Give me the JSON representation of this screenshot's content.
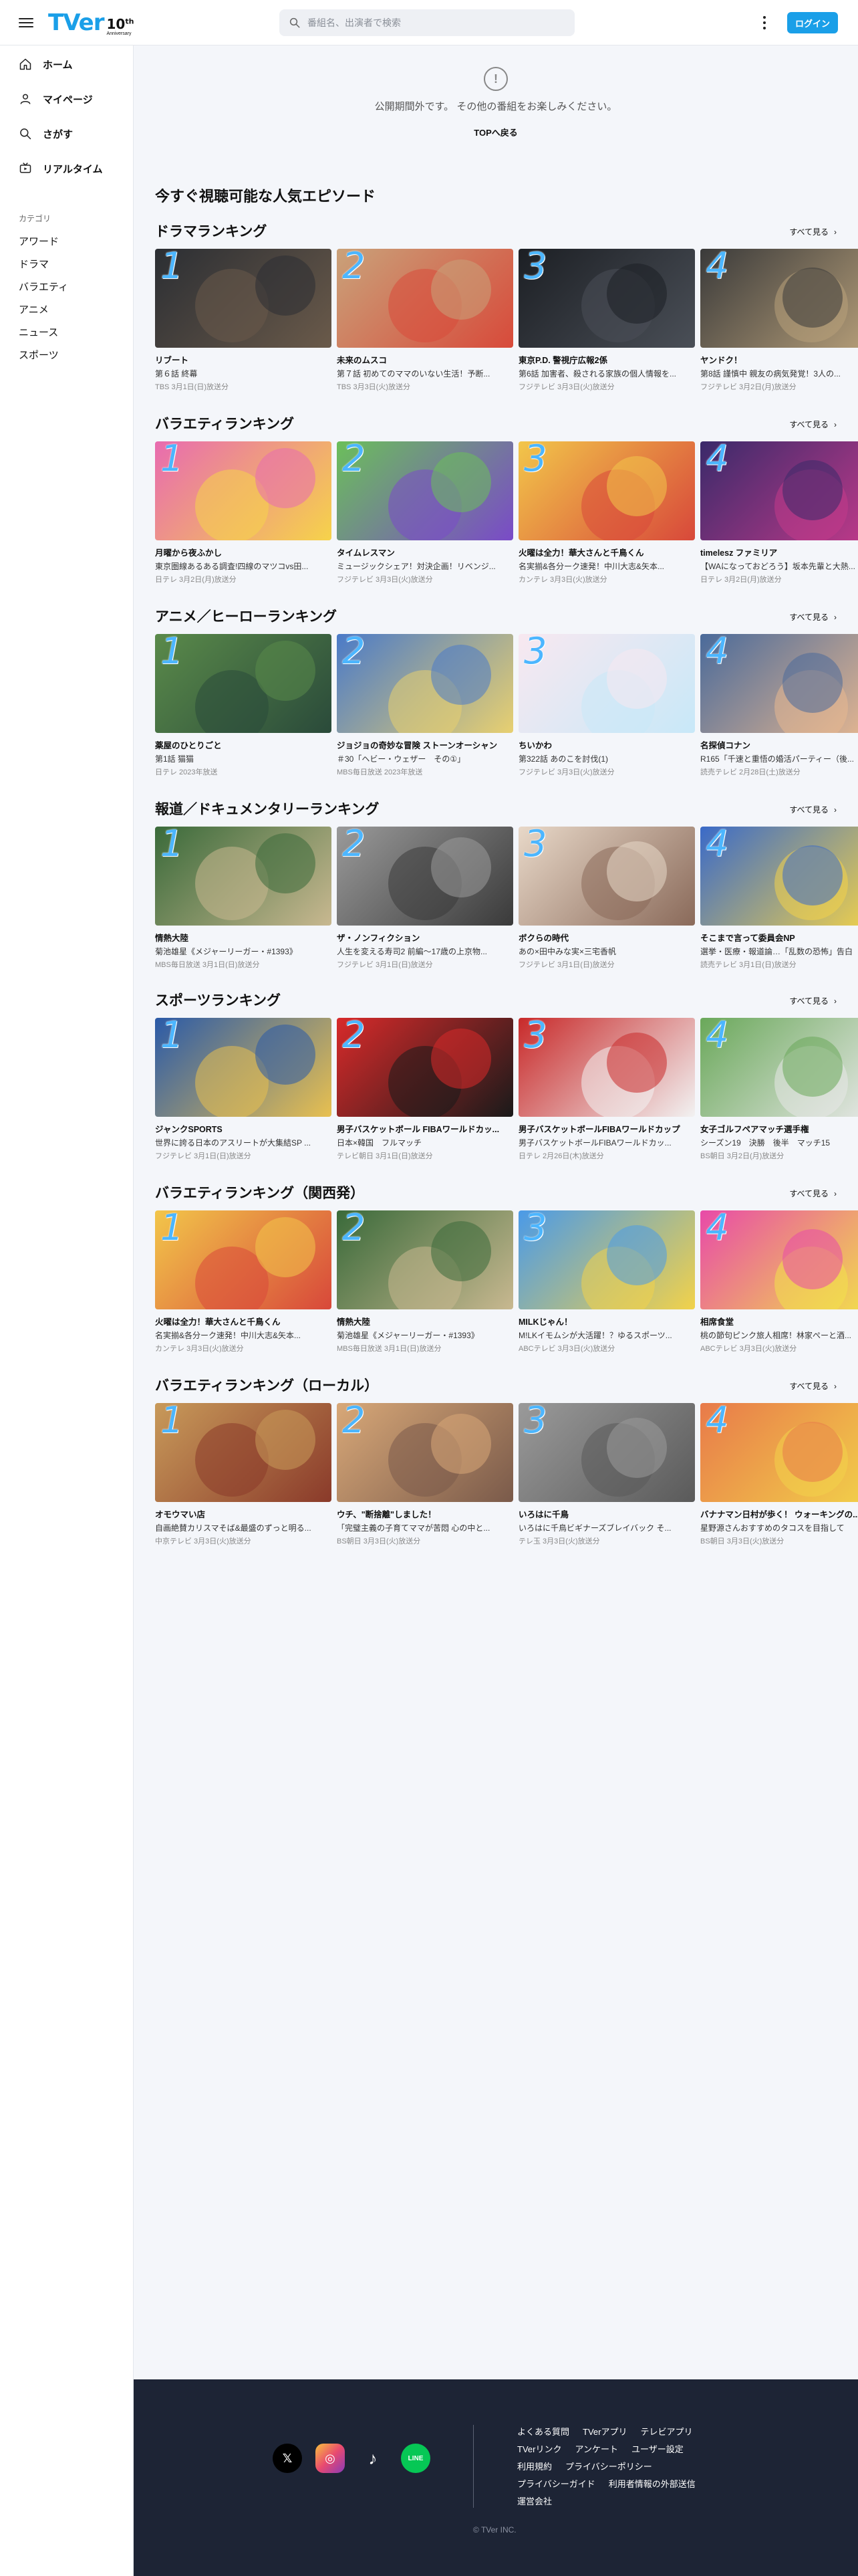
{
  "header": {
    "logo_text": "TVer",
    "logo_badge": "10",
    "logo_badge_sup": "th",
    "logo_badge_sub": "Anniversary",
    "search_placeholder": "番組名、出演者で検索",
    "login_label": "ログイン"
  },
  "sidebar": {
    "nav": [
      {
        "label": "ホーム",
        "icon": "home-icon"
      },
      {
        "label": "マイページ",
        "icon": "user-icon"
      },
      {
        "label": "さがす",
        "icon": "search-icon"
      },
      {
        "label": "リアルタイム",
        "icon": "tv-icon"
      }
    ],
    "category_title": "カテゴリ",
    "categories": [
      "アワード",
      "ドラマ",
      "バラエティ",
      "アニメ",
      "ニュース",
      "スポーツ"
    ]
  },
  "notice": {
    "message": "公開期間外です。 その他の番組をお楽しみください。",
    "top_link": "TOPへ戻る"
  },
  "page_heading": "今すぐ視聴可能な人気エピソード",
  "see_all_label": "すべて見る",
  "sections": [
    {
      "title": "ドラマランキング",
      "cards": [
        {
          "rank": "1",
          "title": "リブート",
          "sub": "第６話 終幕",
          "meta": "TBS 3月1日(日)放送分",
          "colors": [
            "#2b2e33",
            "#6a5a4a"
          ]
        },
        {
          "rank": "2",
          "title": "未来のムスコ",
          "sub": "第７話 初めてのママのいない生活！予断...",
          "meta": "TBS 3月3日(火)放送分",
          "colors": [
            "#c9a27a",
            "#d84a3a"
          ]
        },
        {
          "rank": "3",
          "title": "東京P.D. 警視庁広報2係",
          "sub": "第6話 加害者、殺される家族の個人情報を...",
          "meta": "フジテレビ 3月3日(火)放送分",
          "colors": [
            "#1c1f24",
            "#4a4f57"
          ]
        },
        {
          "rank": "4",
          "title": "ヤンドク！",
          "sub": "第8話 謹慎中 親友の病気発覚！3人の...",
          "meta": "フジテレビ 3月2日(月)放送分",
          "colors": [
            "#3a3a3a",
            "#b8a07a"
          ]
        }
      ]
    },
    {
      "title": "バラエティランキング",
      "cards": [
        {
          "rank": "1",
          "title": "月曜から夜ふかし",
          "sub": "東京圏線あるある調査!四線のマツコvs田...",
          "meta": "日テレ 3月2日(月)放送分",
          "colors": [
            "#e86bb0",
            "#f6d34a"
          ]
        },
        {
          "rank": "2",
          "title": "タイムレスマン",
          "sub": "ミュージックシェア！対決企画！リベンジ...",
          "meta": "フジテレビ 3月3日(火)放送分",
          "colors": [
            "#6bbf5a",
            "#7a4ac8"
          ]
        },
        {
          "rank": "3",
          "title": "火曜は全力！華大さんと千鳥くん",
          "sub": "名実揃&各分ーク速発！中川大志&矢本...",
          "meta": "カンテレ 3月3日(火)放送分",
          "colors": [
            "#f2c64a",
            "#d8483a"
          ]
        },
        {
          "rank": "4",
          "title": "timelesz ファミリア",
          "sub": "【WAになっておどろう】坂本先輩と大熱...",
          "meta": "日テレ 3月2日(月)放送分",
          "colors": [
            "#3a2a6a",
            "#c23a8a"
          ]
        }
      ]
    },
    {
      "title": "アニメ／ヒーローランキング",
      "cards": [
        {
          "rank": "1",
          "title": "薬屋のひとりごと",
          "sub": "第1話 猫猫",
          "meta": "日テレ 2023年放送",
          "colors": [
            "#5a8a4a",
            "#2a4a3a"
          ]
        },
        {
          "rank": "2",
          "title": "ジョジョの奇妙な冒険 ストーンオーシャン",
          "sub": "＃30「ヘビー・ウェザー　その①」",
          "meta": "MBS毎日放送 2023年放送",
          "colors": [
            "#4a7ac8",
            "#e8d070"
          ]
        },
        {
          "rank": "3",
          "title": "ちいかわ",
          "sub": "第322話 あのこを討伐(1)",
          "meta": "フジテレビ 3月3日(火)放送分",
          "colors": [
            "#f8e8f0",
            "#c8e8f8"
          ]
        },
        {
          "rank": "4",
          "title": "名探偵コナン",
          "sub": "R165「千速と重悟の婚活パーティー（後...",
          "meta": "読売テレビ 2月28日(土)放送分",
          "colors": [
            "#4a6a9a",
            "#e8b890"
          ]
        }
      ]
    },
    {
      "title": "報道／ドキュメンタリーランキング",
      "cards": [
        {
          "rank": "1",
          "title": "情熱大陸",
          "sub": "菊池雄星《メジャーリーガー・#1393》",
          "meta": "MBS毎日放送 3月1日(日)放送分",
          "colors": [
            "#3a6a3a",
            "#c8b890"
          ]
        },
        {
          "rank": "2",
          "title": "ザ・ノンフィクション",
          "sub": "人生を変える寿司2 前編～17歳の上京物...",
          "meta": "フジテレビ 3月1日(日)放送分",
          "colors": [
            "#9a9a9a",
            "#3a3a3a"
          ]
        },
        {
          "rank": "3",
          "title": "ボクらの時代",
          "sub": "あの×田中みな実×三宅香帆",
          "meta": "フジテレビ 3月1日(日)放送分",
          "colors": [
            "#e8d8c8",
            "#8a6a5a"
          ]
        },
        {
          "rank": "4",
          "title": "そこまで言って委員会NP",
          "sub": "選挙・医療・報道論…「乱数の恐怖」告白",
          "meta": "読売テレビ 3月1日(日)放送分",
          "colors": [
            "#3a6ac8",
            "#f2d24a"
          ]
        }
      ]
    },
    {
      "title": "スポーツランキング",
      "cards": [
        {
          "rank": "1",
          "title": "ジャンクSPORTS",
          "sub": "世界に誇る日本のアスリートが大集結SP ...",
          "meta": "フジテレビ 3月1日(日)放送分",
          "colors": [
            "#2a5aa8",
            "#e8c050"
          ]
        },
        {
          "rank": "2",
          "title": "男子バスケットボール FIBAワールドカッ...",
          "sub": "日本×韓国　フルマッチ",
          "meta": "テレビ朝日 3月1日(日)放送分",
          "colors": [
            "#d82a2a",
            "#1a1a1a"
          ]
        },
        {
          "rank": "3",
          "title": "男子バスケットボールFIBAワールドカップ",
          "sub": "男子バスケットボールFIBAワールドカッ...",
          "meta": "日テレ 2月26日(木)放送分",
          "colors": [
            "#c82a2a",
            "#f2f2f2"
          ]
        },
        {
          "rank": "4",
          "title": "女子ゴルフペアマッチ選手権",
          "sub": "シーズン19　決勝　後半　マッチ15",
          "meta": "BS朝日 3月2日(月)放送分",
          "colors": [
            "#6aa85a",
            "#e8e8e8"
          ]
        }
      ]
    },
    {
      "title": "バラエティランキング（関西発）",
      "cards": [
        {
          "rank": "1",
          "title": "火曜は全力！華大さんと千鳥くん",
          "sub": "名実揃&各分ーク速発！中川大志&矢本...",
          "meta": "カンテレ 3月3日(火)放送分",
          "colors": [
            "#f2c64a",
            "#d8483a"
          ]
        },
        {
          "rank": "2",
          "title": "情熱大陸",
          "sub": "菊池雄星《メジャーリーガー・#1393》",
          "meta": "MBS毎日放送 3月1日(日)放送分",
          "colors": [
            "#3a6a3a",
            "#c8b890"
          ]
        },
        {
          "rank": "3",
          "title": "MILKじゃん！",
          "sub": "M!LKイモムシが大活躍！？ゆるスポーツ...",
          "meta": "ABCテレビ 3月3日(火)放送分",
          "colors": [
            "#4a9ae8",
            "#f2d24a"
          ]
        },
        {
          "rank": "4",
          "title": "相席食堂",
          "sub": "桃の節句ピンク旅人相席！林家ぺーと酒...",
          "meta": "ABCテレビ 3月3日(火)放送分",
          "colors": [
            "#e84aa8",
            "#f2e24a"
          ]
        }
      ]
    },
    {
      "title": "バラエティランキング（ローカル）",
      "cards": [
        {
          "rank": "1",
          "title": "オモウマい店",
          "sub": "自画絶賛カリスマそば&最盛のずっと明る...",
          "meta": "中京テレビ 3月3日(火)放送分",
          "colors": [
            "#c89a5a",
            "#8a3a2a"
          ]
        },
        {
          "rank": "2",
          "title": "ウチ、\"断捨離\"しました！",
          "sub": "「完璧主義の子育てママが苦悶 心の中と...",
          "meta": "BS朝日 3月3日(火)放送分",
          "colors": [
            "#d8a878",
            "#7a5a4a"
          ]
        },
        {
          "rank": "3",
          "title": "いろはに千鳥",
          "sub": "いろはに千鳥ビギナーズブレイバック そ...",
          "meta": "テレ玉 3月3日(火)放送分",
          "colors": [
            "#9a9a9a",
            "#5a5a5a"
          ]
        },
        {
          "rank": "4",
          "title": "バナナマン日村が歩く！ ウォーキングの...",
          "sub": "星野源さんおすすめのタコスを目指して",
          "meta": "BS朝日 3月3日(火)放送分",
          "colors": [
            "#e87a4a",
            "#f2d24a"
          ]
        }
      ]
    }
  ],
  "footer": {
    "social": [
      {
        "name": "x-icon",
        "glyph": "𝕏"
      },
      {
        "name": "instagram-icon",
        "glyph": "◎"
      },
      {
        "name": "tiktok-icon",
        "glyph": "♪"
      },
      {
        "name": "line-icon",
        "glyph": "LINE"
      }
    ],
    "link_rows": [
      [
        "よくある質問",
        "TVerアプリ",
        "テレビアプリ"
      ],
      [
        "TVerリンク",
        "アンケート",
        "ユーザー設定"
      ],
      [
        "利用規約",
        "プライバシーポリシー"
      ],
      [
        "プライバシーガイド",
        "利用者情報の外部送信"
      ],
      [
        "運営会社"
      ]
    ],
    "copyright": "© TVer INC."
  },
  "colors": {
    "brand": "#1a9fe8",
    "footer_bg": "#1d2435",
    "rank_number": "#4cb6ff"
  }
}
